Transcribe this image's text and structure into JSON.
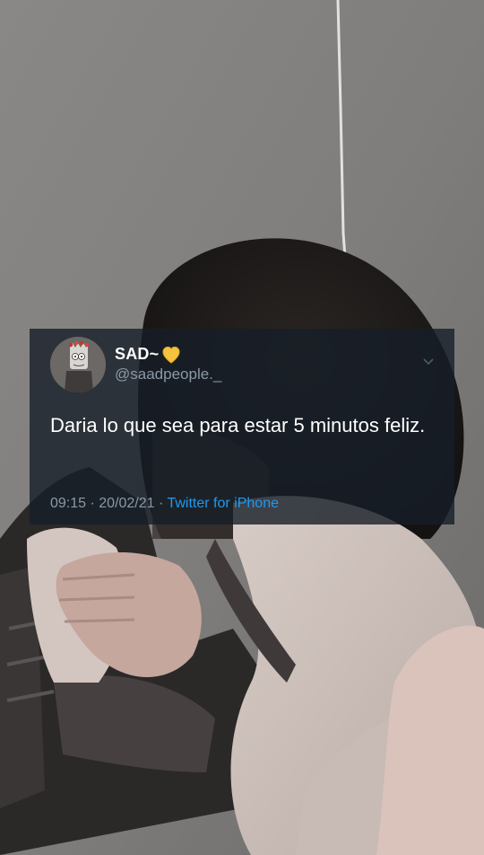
{
  "tweet": {
    "display_name": "SAD~",
    "name_emoji_icon": "yellow-heart-icon",
    "handle": "@saadpeople._",
    "text": "Daria lo que sea para estar 5 minutos feliz.",
    "time": "09:15",
    "separator": " · ",
    "date": "20/02/21",
    "source": "Twitter for iPhone",
    "colors": {
      "card_bg": "#171e28",
      "text": "#ffffff",
      "secondary": "#8b98a5",
      "link": "#1d9bf0",
      "heart": "#f4c23e"
    }
  },
  "background": {
    "icon": "photo-person-hugging-knees"
  }
}
